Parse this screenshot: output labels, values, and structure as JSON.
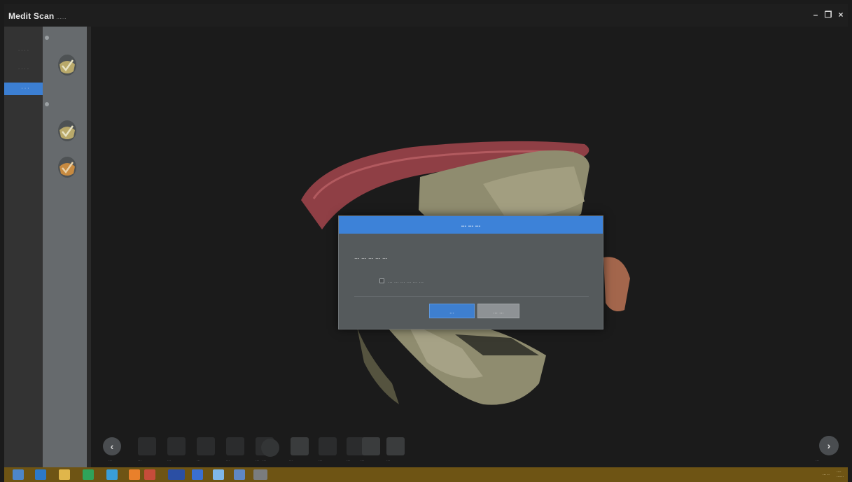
{
  "window": {
    "title": "Medit Scan",
    "title_suffix": "......",
    "controls": {
      "minimize": "–",
      "restore": "❐",
      "close": "×"
    }
  },
  "left_nav": {
    "items": [
      {
        "label": "· · · ·",
        "active": false
      },
      {
        "label": "· · · ·",
        "active": false
      },
      {
        "label": "· · ·",
        "active": true
      }
    ]
  },
  "steps": [
    {
      "icon": "checked-scan-icon",
      "color": "#b9a96a"
    },
    {
      "icon": "checked-scan-icon",
      "color": "#b9a96a"
    },
    {
      "icon": "pending-scan-icon",
      "color": "#c78a40"
    }
  ],
  "dialog": {
    "title": "... ... ...",
    "message": "... ... ... ... ...",
    "checkbox_label": "... ... ... ... ... ...",
    "ok_label": "...",
    "cancel_label": "... ..."
  },
  "toolbar": {
    "prev_label": "...",
    "tools": [
      "...",
      "...",
      "...",
      "...",
      "...",
      "...",
      "...",
      "...",
      "...",
      "...",
      "..."
    ],
    "next_label": "..."
  },
  "colors": {
    "accent": "#3d82d8",
    "taskbar": "#6e5414",
    "model_tooth": "#8f8c6f",
    "model_gum": "#8f3f45"
  },
  "tray": {
    "lang": "... ..",
    "time": "....",
    "date": "......"
  }
}
